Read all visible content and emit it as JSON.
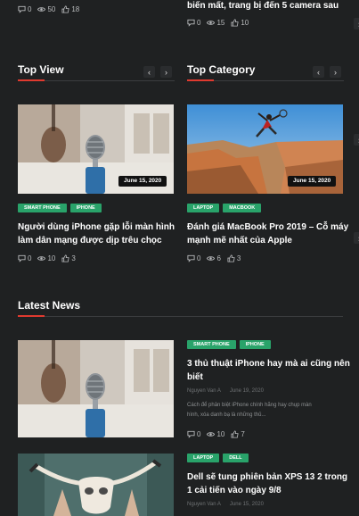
{
  "top": {
    "left_meta": {
      "comments": "0",
      "views": "50",
      "likes": "18"
    },
    "right_title": "biến mất, trang bị đến 5 camera sau",
    "right_meta": {
      "comments": "0",
      "views": "15",
      "likes": "10"
    }
  },
  "top_view": {
    "title": "Top View",
    "prev": "‹",
    "next": "›",
    "post": {
      "date": "June 15, 2020",
      "tags": [
        "SMART PHONE",
        "IPHONE"
      ],
      "title_line1": "Người dùng iPhone gặp lỗi màn hình",
      "title_line2": "làm dân mạng được dịp trêu chọc",
      "comments": "0",
      "views": "10",
      "likes": "3"
    }
  },
  "top_category": {
    "title": "Top Category",
    "prev": "‹",
    "next": "›",
    "post": {
      "date": "June 15, 2020",
      "tags": [
        "LAPTOP",
        "MACBOOK"
      ],
      "title_line1": "Đánh giá MacBook Pro 2019 – Cỗ máy",
      "title_line2": "mạnh mẽ nhất của Apple",
      "comments": "0",
      "views": "6",
      "likes": "3"
    }
  },
  "latest_news": {
    "title": "Latest News",
    "posts": [
      {
        "tags": [
          "SMART PHONE",
          "IPHONE"
        ],
        "title_line1": "3 thủ thuật iPhone hay mà ai cũng nên",
        "title_line2": "biết",
        "author": "Nguyen Van A",
        "date": "June 19, 2020",
        "excerpt_line1": "Cách để phân biệt iPhone chính hãng hay chụp màn",
        "excerpt_line2": "hình, xóa danh bạ là những thủ...",
        "comments": "0",
        "views": "10",
        "likes": "7"
      },
      {
        "tags": [
          "LAPTOP",
          "DELL"
        ],
        "title_line1": "Dell sẽ tung phiên bản XPS 13 2 trong",
        "title_line2": "1 cải tiến vào ngày 9/8",
        "author": "Nguyen Van A",
        "date": "June 15, 2020"
      }
    ]
  },
  "colors": {
    "background": "#1f2122",
    "accent": "#e03a2f",
    "tag": "#29a36a"
  },
  "icons": [
    "comment-icon",
    "eye-icon",
    "thumbs-up-icon",
    "chevron-left-icon",
    "chevron-right-icon"
  ]
}
